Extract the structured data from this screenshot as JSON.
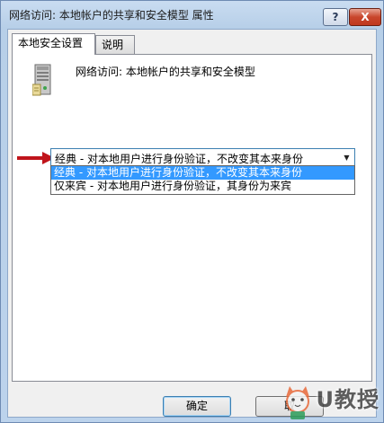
{
  "window": {
    "title": "网络访问: 本地帐户的共享和安全模型 属性",
    "help_label": "?",
    "close_label": "X"
  },
  "tabs": [
    {
      "label": "本地安全设置",
      "active": true
    },
    {
      "label": "说明",
      "active": false
    }
  ],
  "policy": {
    "title": "网络访问: 本地帐户的共享和安全模型",
    "icon": "server-icon"
  },
  "combo": {
    "selected": "经典 - 对本地用户进行身份验证，不改变其本来身份",
    "options": [
      "经典 - 对本地用户进行身份验证，不改变其本来身份",
      "仅来宾 - 对本地用户进行身份验证，其身份为来宾"
    ],
    "highlighted_index": 0
  },
  "buttons": {
    "ok_label": "确定",
    "cancel_label": "取"
  },
  "annotation": {
    "arrow_color": "#c0141b"
  },
  "watermark": {
    "text": "U教授",
    "icon": "cat-mascot-icon"
  }
}
